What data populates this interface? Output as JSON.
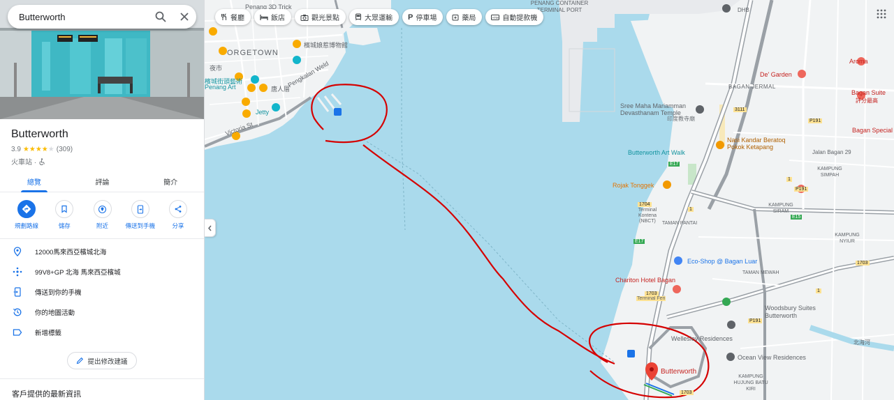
{
  "search": {
    "value": "Butterworth"
  },
  "place": {
    "name": "Butterworth",
    "rating": "3.9",
    "stars_filled": 4,
    "reviews": "(309)",
    "category": "火車站 ·"
  },
  "tabs": [
    {
      "label": "總覽"
    },
    {
      "label": "評論"
    },
    {
      "label": "簡介"
    }
  ],
  "actions": [
    {
      "label": "規劃路線",
      "icon": "directions-icon"
    },
    {
      "label": "儲存",
      "icon": "bookmark-icon"
    },
    {
      "label": "附近",
      "icon": "nearby-icon"
    },
    {
      "label": "傳送到手機",
      "icon": "send-to-phone-icon"
    },
    {
      "label": "分享",
      "icon": "share-icon"
    }
  ],
  "info": {
    "address": "12000馬來西亞檳城北海",
    "plus_code": "99V8+GP 北海 馬來西亞檳城",
    "send_to_phone": "傳送到你的手機",
    "map_activity": "你的地圖活動",
    "add_label": "新增標籤"
  },
  "suggest_edit": "提出修改建議",
  "latest_info": "客戶提供的最新資訊",
  "chips": [
    {
      "label": "餐廳",
      "icon": "restaurant-icon"
    },
    {
      "label": "飯店",
      "icon": "hotel-icon"
    },
    {
      "label": "觀光景點",
      "icon": "camera-icon"
    },
    {
      "label": "大眾運輸",
      "icon": "transit-icon"
    },
    {
      "label": "停車場",
      "icon": "parking-icon"
    },
    {
      "label": "藥局",
      "icon": "pharmacy-icon"
    },
    {
      "label": "自動提款機",
      "icon": "atm-icon"
    }
  ],
  "map_labels": {
    "georgetown": "ORGETOWN",
    "penang_3d": "Penang 3D Trick",
    "museum_1": "檳城娘惹博物館",
    "night_market": "夜市",
    "street_art": "檳城街頭藝術",
    "penang_art": "Penang Art",
    "chinatown": "唐人厝",
    "pengkalan_weld": "Pengkalan Weld",
    "jetty": "Jetty",
    "victoria_st": "Victoria St",
    "penang_container_port": "PENANG CONTAINER TERMINAL PORT",
    "sree_maha": "Sree Maha Mariamman Devasthanam Temple",
    "temple_cn": "印度教寺廟",
    "bagan_jermal": "BAGAN JERMAL",
    "de_garden": "De' Garden",
    "aroma": "Aroma",
    "bagan_suite": "Bagan Suite",
    "bagan_suite_cn": "評分最高",
    "bagan_special": "Bagan Special",
    "nasi_kandar": "Nasi Kandar Beratoq Pokok Ketapang",
    "butterworth_art_walk": "Butterworth Art Walk",
    "jalan_bagan": "Jalan Bagan 29",
    "kampung_simpah": "KAMPUNG SIMPAH",
    "rojak": "Rojak Tonggek",
    "terminal_ncbt": "Terminal Kontena (NBCT)",
    "taman_pantai": "TAMAN PANTAI",
    "kampung_siram": "KAMPUNG SIRAM",
    "kampung_nyiur": "KAMPUNG NYIUR",
    "eco_shop": "Eco-Shop @ Bagan Luar",
    "taman_mewah": "TAMAN MEWAH",
    "chariton": "Chariton Hotel Bagan",
    "terminal_feri": "Terminal Feri",
    "woodsbury": "Woodsbury Suites Butterworth",
    "wellesley": "Wellesley Residences",
    "ocean_view": "Ocean View Residences",
    "kampung_hujung": "KAMPUNG HUJUNG BATU KIRI",
    "river": "北海河",
    "butterworth_pin": "Butterworth",
    "road_1704": "1704",
    "road_1703": "1703",
    "road_1703b": "1703",
    "road_e17": "E17",
    "road_e17b": "E17",
    "road_e15": "E15",
    "road_1": "1",
    "road_1b": "1",
    "road_1c": "1",
    "road_p191": "P191",
    "road_p191b": "P191",
    "road_p191c": "P191",
    "road_3111": "3111",
    "road_1703c": "1703",
    "dhb": "DHB"
  },
  "colors": {
    "accent": "#1a73e8",
    "water": "#a8d8ea",
    "land": "#f1f3f4",
    "annotation": "#d50000",
    "pin": "#ea4335"
  }
}
